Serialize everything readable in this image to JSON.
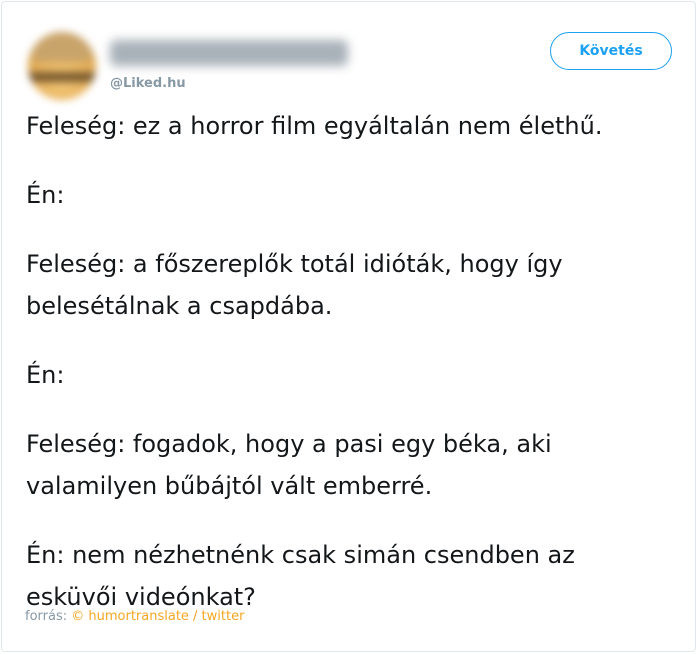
{
  "tweet": {
    "handle": "@Liked.hu",
    "follow_label": "Követés",
    "paragraphs": [
      "Feleség: ez a horror film egyáltalán nem élethű.",
      "Én:",
      "Feleség: a főszereplők totál idióták, hogy így belesétálnak a csapdába.",
      "Én:",
      "Feleség: fogadok, hogy a pasi egy béka, aki valamilyen bűbájtól vált emberré.",
      "Én: nem nézhetnénk csak simán csendben az esküvői videónkat?"
    ]
  },
  "footer": {
    "prefix": "forrás: ",
    "source": "© humortranslate / twitter"
  },
  "colors": {
    "accent": "#1da1f2",
    "text": "#14171a",
    "muted": "#8899a6",
    "source_link": "#f5a623"
  }
}
